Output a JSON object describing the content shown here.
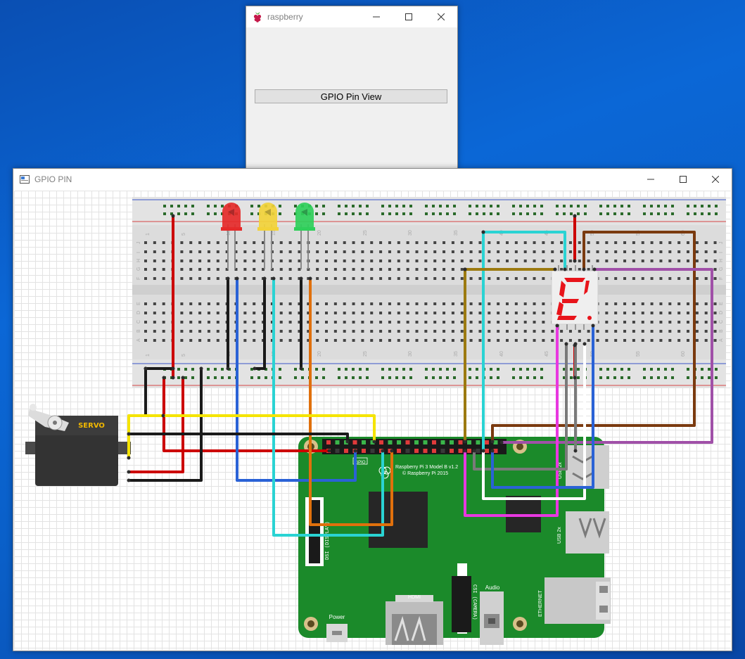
{
  "raspberry_window": {
    "title": "raspberry",
    "button_label": "GPIO Pin View"
  },
  "gpio_window": {
    "title": "GPIO PIN"
  },
  "breadboard": {
    "column_numbers": [
      "1",
      "5",
      "10",
      "15",
      "20",
      "25",
      "30",
      "35",
      "40",
      "45",
      "50",
      "55",
      "60"
    ],
    "row_letters_top": [
      "J",
      "I",
      "H",
      "G",
      "F"
    ],
    "row_letters_bottom": [
      "E",
      "D",
      "C",
      "B",
      "A"
    ]
  },
  "servo": {
    "label": "SERVO"
  },
  "pi_board": {
    "model_line1": "Raspberry Pi 3 Model B v1.2",
    "model_line2": "© Raspberry Pi 2015",
    "gpio_label": "GPIO",
    "dsi_label": "DSI (DISPLAY)",
    "csi_label": "CSI (CAMERA)",
    "hdmi_label": "HDMI",
    "audio_label": "Audio",
    "power_label": "Power",
    "ethernet_label": "ETHERNET",
    "usb_label_1": "USB 2x",
    "usb_label_2": "USB 2x"
  },
  "leds": [
    {
      "color": "#e52a2a"
    },
    {
      "color": "#f2d23a"
    },
    {
      "color": "#2fcf5a"
    }
  ],
  "seven_segment": {
    "digit_color": "#e8141b"
  },
  "wire_colors": {
    "red": "#cc0000",
    "black": "#1a1a1a",
    "yellow": "#f5e400",
    "blue": "#2a62d6",
    "cyan": "#2ad3d3",
    "orange": "#e0700c",
    "olive": "#9c7a10",
    "brown": "#7a3a0f",
    "purple": "#a050a8",
    "magenta": "#e838e0",
    "gray": "#7a7a7a",
    "white": "#ffffff"
  }
}
